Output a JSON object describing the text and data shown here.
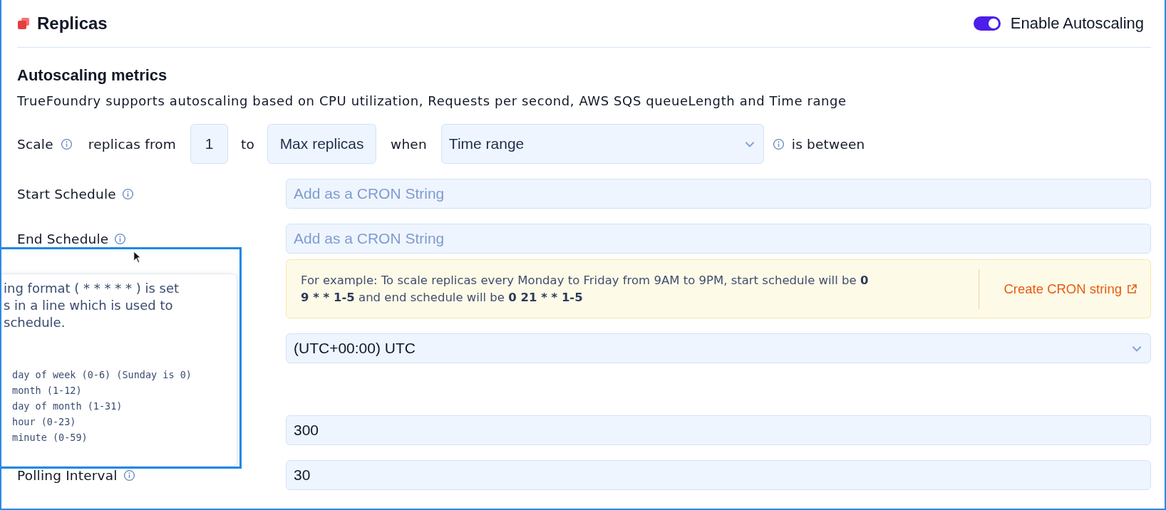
{
  "header": {
    "title": "Replicas",
    "toggle": {
      "label": "Enable Autoscaling",
      "on": true
    }
  },
  "section": {
    "title": "Autoscaling metrics",
    "description": "TrueFoundry supports autoscaling based on CPU utilization, Requests per second, AWS SQS queueLength and Time range"
  },
  "scale_row": {
    "label": "Scale",
    "from_text": "replicas from",
    "min_value": "1",
    "to_text": "to",
    "max_value": "Max replicas",
    "when_text": "when",
    "metric": "Time range",
    "suffix": "is between"
  },
  "fields": [
    {
      "kind": "input",
      "label": "Start Schedule",
      "placeholder": "Add as a CRON String"
    },
    {
      "kind": "input",
      "label": "End Schedule",
      "placeholder": "Add as a CRON String"
    },
    {
      "kind": "callout",
      "parts": [
        {
          "text": "For example: To scale replicas every Monday to Friday from 9AM to 9PM, start schedule will be ",
          "bold": false
        },
        {
          "text": "0 9 * * 1-5",
          "bold": true
        },
        {
          "text": " and end schedule will be ",
          "bold": false
        },
        {
          "text": "0 21 * * 1-5",
          "bold": true
        }
      ],
      "link": "Create CRON string"
    },
    {
      "kind": "select",
      "value": "(UTC+00:00) UTC"
    },
    {
      "kind": "input",
      "value": "300"
    },
    {
      "kind": "input",
      "label": "Polling Interval",
      "value": "30"
    }
  ],
  "tooltip": {
    "lines": [
      "ing format ( * * * * * ) is set",
      "s in a line which is used to",
      "schedule."
    ],
    "code_lines": [
      "day of week (0-6) (Sunday is 0)",
      "month (1-12)",
      "day of month (1-31)",
      "hour (0-23)",
      "minute (0-59)"
    ]
  }
}
